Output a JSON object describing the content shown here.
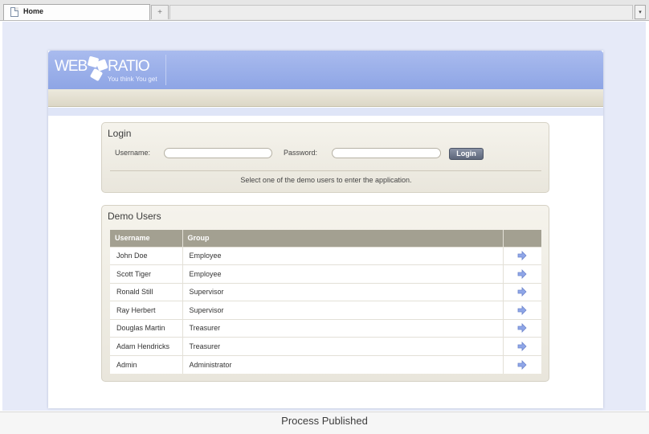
{
  "browser": {
    "tabs": [
      {
        "label": "Home"
      }
    ],
    "new_tab_symbol": "+",
    "menu_symbol": "▾"
  },
  "header": {
    "logo_left": "WEB",
    "logo_right": "RATIO",
    "logo_tagline": "You think You get"
  },
  "login": {
    "title": "Login",
    "username_label": "Username:",
    "password_label": "Password:",
    "username_value": "",
    "password_value": "",
    "button_label": "Login",
    "hint": "Select one of the demo users to enter the application."
  },
  "demo_users": {
    "title": "Demo Users",
    "columns": [
      "Username",
      "Group",
      ""
    ],
    "rows": [
      {
        "username": "John Doe",
        "group": "Employee"
      },
      {
        "username": "Scott Tiger",
        "group": "Employee"
      },
      {
        "username": "Ronald Still",
        "group": "Supervisor"
      },
      {
        "username": "Ray Herbert",
        "group": "Supervisor"
      },
      {
        "username": "Douglas Martin",
        "group": "Treasurer"
      },
      {
        "username": "Adam Hendricks",
        "group": "Treasurer"
      },
      {
        "username": "Admin",
        "group": "Administrator"
      }
    ],
    "row_action_icon": "arrow-right-icon"
  },
  "status_bar": {
    "text": "Process Published"
  },
  "colors": {
    "header_blue": "#8ea5e5",
    "nav_beige": "#dcd7c6",
    "table_header": "#a3a091",
    "arrow_blue": "#8fa6e8",
    "page_background": "#e6eaf8"
  }
}
